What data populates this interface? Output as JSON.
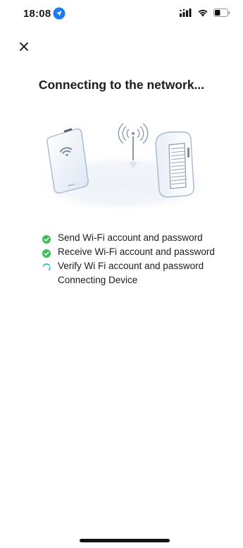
{
  "status_bar": {
    "time": "18:08",
    "location_icon": "location-arrow-icon",
    "signal_icon": "cellular-signal-icon",
    "wifi_icon": "wifi-icon",
    "battery_icon": "battery-icon"
  },
  "header": {
    "close_icon": "close-icon"
  },
  "title": "Connecting to the network...",
  "illustration": {
    "phone_icon": "smartphone-wifi-icon",
    "antenna_icon": "antenna-broadcast-icon",
    "device_icon": "router-device-icon"
  },
  "steps": [
    {
      "label": "Send Wi-Fi account and password",
      "status": "done"
    },
    {
      "label": "Receive Wi-Fi account and password",
      "status": "done"
    },
    {
      "label": "Verify Wi Fi account and password",
      "status": "in-progress"
    },
    {
      "label": "Connecting Device",
      "status": "pending"
    }
  ],
  "colors": {
    "done": "#3cbf5a",
    "progress": "#1ab0c7",
    "location_blue": "#1c7cf2"
  }
}
